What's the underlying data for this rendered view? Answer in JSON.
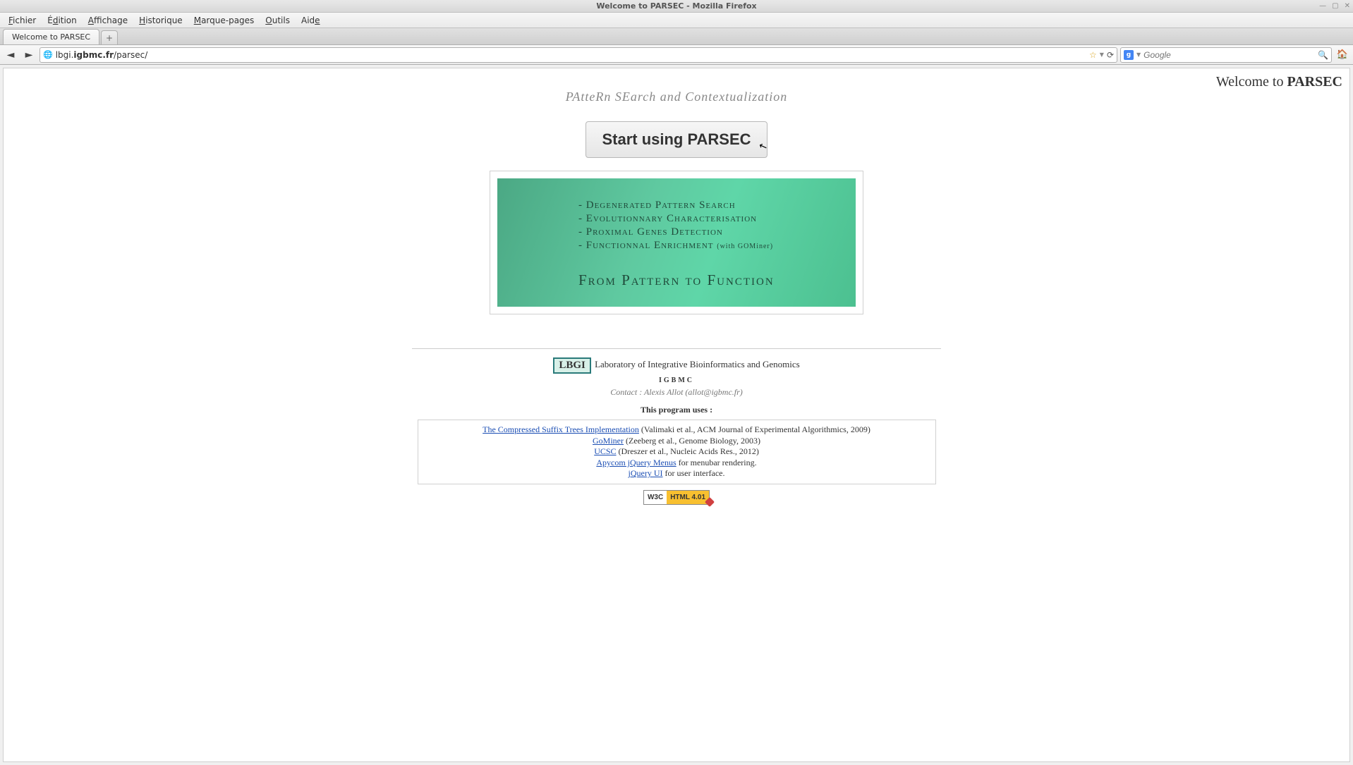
{
  "window": {
    "title": "Welcome to PARSEC - Mozilla Firefox"
  },
  "menu": {
    "file": "Fichier",
    "edit": "Édition",
    "view": "Affichage",
    "history": "Historique",
    "bookmarks": "Marque-pages",
    "tools": "Outils",
    "help": "Aide"
  },
  "tab": {
    "title": "Welcome to PARSEC"
  },
  "url": {
    "prefix": "lbgi.",
    "domain": "igbmc.fr",
    "path": "/parsec/"
  },
  "search": {
    "engine_letter": "g",
    "placeholder": "Google"
  },
  "page": {
    "welcome_prefix": "Welcome to ",
    "welcome_name": "PARSEC",
    "subtitle": "PAtteRn SEarch and Contextualization",
    "start_button": "Start using PARSEC",
    "banner": {
      "feat1": "- Degenerated Pattern Search",
      "feat2": "- Evolutionnary Characterisation",
      "feat3": "- Proximal Genes Detection",
      "feat4": "- Functionnal Enrichment ",
      "feat4_with": "(with GOMiner)",
      "slogan": "From Pattern to Function"
    },
    "footer": {
      "lbgi_badge": "LBGI",
      "lab_name": " Laboratory of Integrative Bioinformatics and Genomics",
      "igbmc": "IGBMC",
      "contact": "Contact : Alexis Allot (allot@igbmc.fr)",
      "uses_label": "This program uses :",
      "refs": [
        {
          "link": "The Compressed Suffix Trees Implementation",
          "tail": " (Valimaki et al., ACM Journal of Experimental Algorithmics, 2009)"
        },
        {
          "link": "GoMiner",
          "tail": " (Zeeberg et al., Genome Biology, 2003)"
        },
        {
          "link": "UCSC",
          "tail": " (Dreszer et al., Nucleic Acids Res., 2012)"
        },
        {
          "link": "Apycom jQuery Menus",
          "tail": " for menubar rendering."
        },
        {
          "link": "jQuery UI",
          "tail": " for user interface."
        }
      ],
      "w3c_left": "W3C",
      "w3c_right": "HTML 4.01"
    }
  }
}
